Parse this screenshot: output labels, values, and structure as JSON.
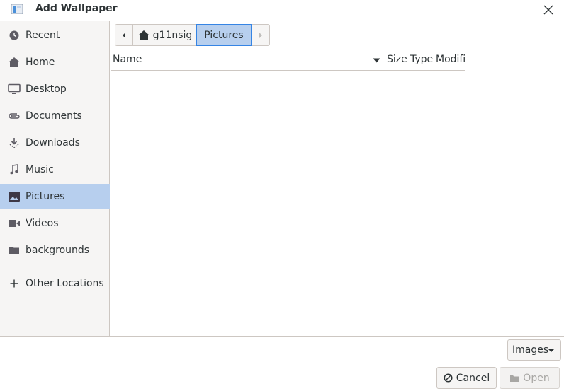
{
  "window": {
    "title": "Add Wallpaper"
  },
  "sidebar": {
    "items": [
      {
        "label": "Recent",
        "icon": "clock-icon",
        "selected": false
      },
      {
        "label": "Home",
        "icon": "home-icon",
        "selected": false
      },
      {
        "label": "Desktop",
        "icon": "monitor-icon",
        "selected": false
      },
      {
        "label": "Documents",
        "icon": "paperclip-icon",
        "selected": false
      },
      {
        "label": "Downloads",
        "icon": "download-icon",
        "selected": false
      },
      {
        "label": "Music",
        "icon": "music-note-icon",
        "selected": false
      },
      {
        "label": "Pictures",
        "icon": "picture-icon",
        "selected": true
      },
      {
        "label": "Videos",
        "icon": "video-camera-icon",
        "selected": false
      },
      {
        "label": "backgrounds",
        "icon": "folder-icon",
        "selected": false
      },
      {
        "label": "Other Locations",
        "icon": "plus-icon",
        "selected": false
      }
    ]
  },
  "pathbar": {
    "segments": [
      {
        "label": "g11nsig",
        "icon": "home-icon"
      },
      {
        "label": "Pictures",
        "active": true
      }
    ]
  },
  "file_list": {
    "columns": {
      "name": "Name",
      "size": "Size",
      "type": "Type",
      "modified": "Modifi"
    },
    "rows": []
  },
  "footer": {
    "filter_value": "Images",
    "cancel_label": "Cancel",
    "open_label": "Open"
  },
  "colors": {
    "selection": "#b7cfee",
    "accent": "#3584e4",
    "sidebar_bg": "#f6f5f4",
    "text": "#2e3436",
    "border": "#cdc7c2"
  }
}
